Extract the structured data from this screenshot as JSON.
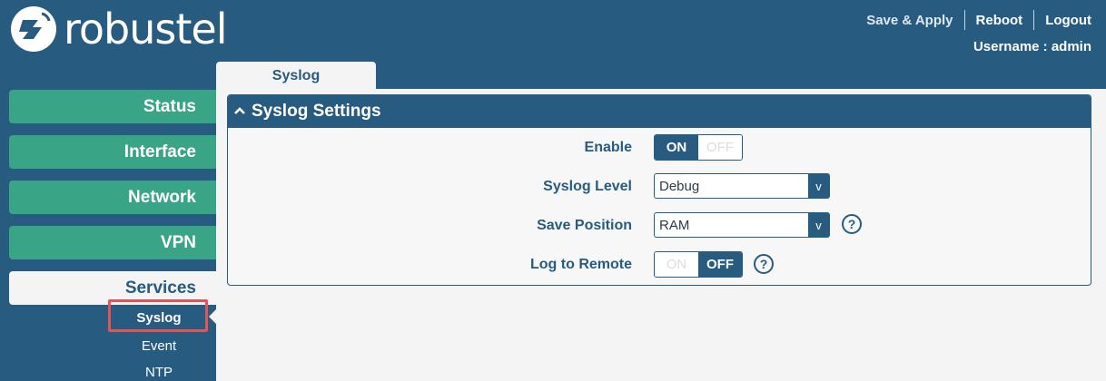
{
  "header": {
    "logo_text": "robustel",
    "nav": {
      "save_apply": "Save & Apply",
      "reboot": "Reboot",
      "logout": "Logout"
    },
    "user_line": "Username : admin"
  },
  "sidebar": {
    "items": [
      {
        "label": "Status"
      },
      {
        "label": "Interface"
      },
      {
        "label": "Network"
      },
      {
        "label": "VPN"
      },
      {
        "label": "Services"
      }
    ],
    "sub_items": [
      {
        "label": "Syslog"
      },
      {
        "label": "Event"
      },
      {
        "label": "NTP"
      }
    ]
  },
  "tab": {
    "label": "Syslog"
  },
  "panel": {
    "title": "Syslog Settings",
    "fields": {
      "enable": {
        "label": "Enable",
        "on": "ON",
        "off": "OFF",
        "state": "on"
      },
      "level": {
        "label": "Syslog Level",
        "value": "Debug",
        "arrow": "v"
      },
      "position": {
        "label": "Save Position",
        "value": "RAM",
        "arrow": "v",
        "help": "?"
      },
      "remote": {
        "label": "Log to Remote",
        "on": "ON",
        "off": "OFF",
        "state": "off",
        "help": "?"
      }
    }
  }
}
